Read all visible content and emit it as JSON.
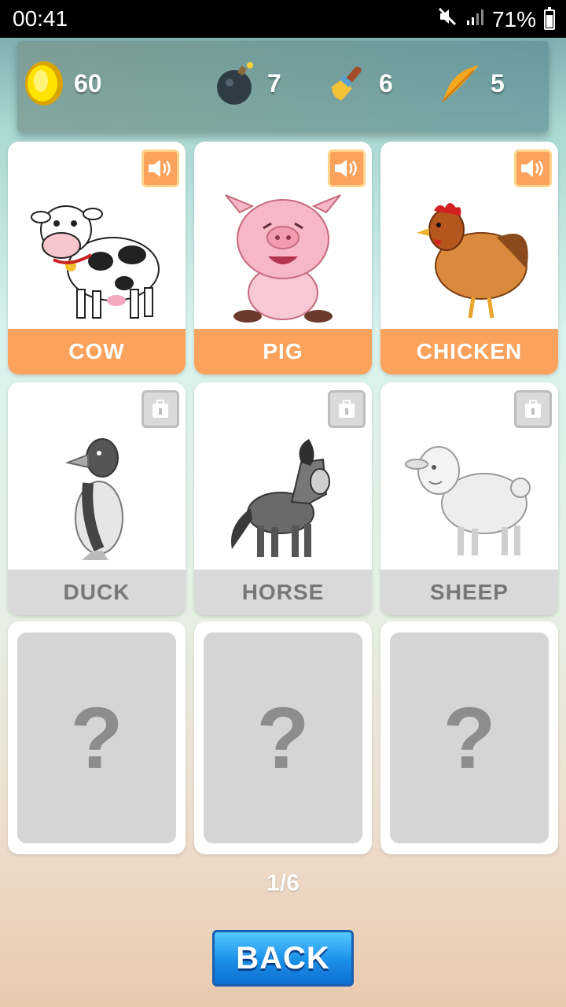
{
  "status_bar": {
    "time": "00:41",
    "battery_percent": "71%"
  },
  "resources": {
    "coins": "60",
    "bombs": "7",
    "brushes": "6",
    "feathers": "5"
  },
  "cards": [
    {
      "label": "COW",
      "state": "unlocked",
      "icon": "speaker-icon"
    },
    {
      "label": "PIG",
      "state": "unlocked",
      "icon": "speaker-icon"
    },
    {
      "label": "CHICKEN",
      "state": "unlocked",
      "icon": "speaker-icon"
    },
    {
      "label": "DUCK",
      "state": "locked",
      "icon": "lock-icon"
    },
    {
      "label": "HORSE",
      "state": "locked",
      "icon": "lock-icon"
    },
    {
      "label": "SHEEP",
      "state": "locked",
      "icon": "lock-icon"
    }
  ],
  "mystery": {
    "symbol": "?"
  },
  "pager": {
    "text": "1/6"
  },
  "buttons": {
    "back": "BACK"
  },
  "colors": {
    "accent": "#fba25c",
    "locked": "#d9d9d9",
    "button": "#1a8fe8"
  }
}
